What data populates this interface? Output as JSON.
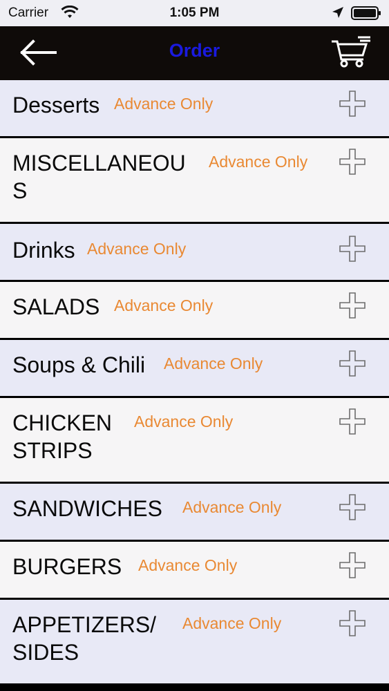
{
  "status": {
    "carrier": "Carrier",
    "time": "1:05 PM"
  },
  "nav": {
    "title": "Order",
    "back_icon": "back-arrow-icon",
    "cart_icon": "shopping-cart-icon"
  },
  "categories": [
    {
      "name": "Desserts",
      "tag": "Advance Only"
    },
    {
      "name": "MISCELLANEOU",
      "name2": "S",
      "tag": "Advance Only"
    },
    {
      "name": "Drinks",
      "tag": "Advance Only"
    },
    {
      "name": "SALADS",
      "tag": "Advance Only"
    },
    {
      "name": "Soups & Chili",
      "tag": "Advance Only"
    },
    {
      "name": "CHICKEN",
      "name2": "STRIPS",
      "tag": "Advance Only"
    },
    {
      "name": "SANDWICHES",
      "tag": "Advance Only"
    },
    {
      "name": "BURGERS",
      "tag": "Advance Only"
    },
    {
      "name": "APPETIZERS/",
      "name2": "SIDES",
      "tag": "Advance Only"
    }
  ],
  "colors": {
    "title": "#1a1adf",
    "tag": "#e98933",
    "nav_bg": "#0f0b09"
  }
}
